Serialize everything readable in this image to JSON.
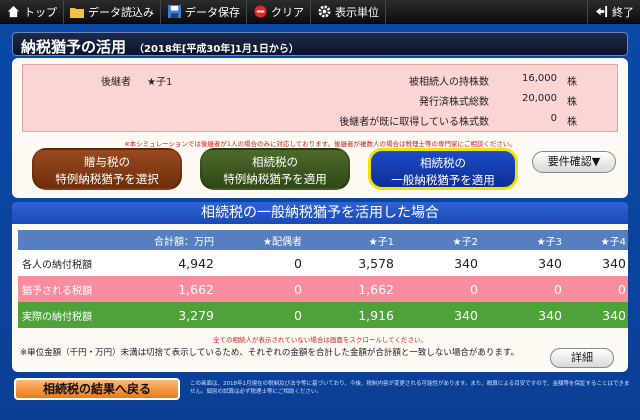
{
  "menu": {
    "top": "トップ",
    "load": "データ読込み",
    "save": "データ保存",
    "clear": "クリア",
    "unit": "表示単位",
    "exit": "終了"
  },
  "title": {
    "main": "納税猶予の活用",
    "sub": "（2018年[平成30年]1月1日から）"
  },
  "info": {
    "successor_label": "後継者",
    "successor_value": "★子1",
    "rows": [
      {
        "label": "被相続人の持株数",
        "value": "16,000",
        "unit": "株"
      },
      {
        "label": "発行済株式総数",
        "value": "20,000",
        "unit": "株"
      },
      {
        "label": "後継者が既に取得している株式数",
        "value": "0",
        "unit": "株"
      }
    ]
  },
  "notice_top": "※本シミュレーションでは後継者が1人の場合のみに対応しております。後継者が複数人の場合は税理士等の専門家にご相談ください。",
  "buttons": {
    "gift_line1": "贈与税の",
    "gift_line2": "特例納税猶予を選択",
    "special_line1": "相続税の",
    "special_line2": "特例納税猶予を適用",
    "general_line1": "相続税の",
    "general_line2": "一般納税猶予を適用",
    "requirements": "要件確認▼",
    "detail": "詳細",
    "back": "相続税の結果へ戻る"
  },
  "result": {
    "header": "相続税の一般納税猶予を活用した場合",
    "columns": [
      "合計額：万円",
      "★配偶者",
      "★子1",
      "★子2",
      "★子3",
      "★子4"
    ],
    "rows": [
      {
        "label": "各人の納付税額",
        "values": [
          "4,942",
          "0",
          "3,578",
          "340",
          "340",
          "340"
        ]
      },
      {
        "label": "猶予される税額",
        "values": [
          "1,662",
          "0",
          "1,662",
          "0",
          "0",
          "0"
        ]
      },
      {
        "label": "実際の納付税額",
        "values": [
          "3,279",
          "0",
          "1,916",
          "340",
          "340",
          "340"
        ]
      }
    ],
    "note_red": "全ての相続人が表示されていない場合は画面をスクロールしてください。",
    "note_black": "※単位金額（千円・万円）未満は切捨て表示しているため、それぞれの金額を合計した金額が合計額と一致しない場合があります。"
  },
  "footer_note": "この画面は、2018年1月現在の税制及び法令等に基づいており、今後、税制内容が変更される可能性があります。また、概算による目安ですので、金額等を保証することはできません。個別の試算は必ず税理士等にご相談ください。",
  "colors": {
    "gift": "#7a3514",
    "special": "#3b5520",
    "general": "#1a44b8",
    "defer_row": "#f98da0",
    "actual_row": "#4fa23a"
  }
}
